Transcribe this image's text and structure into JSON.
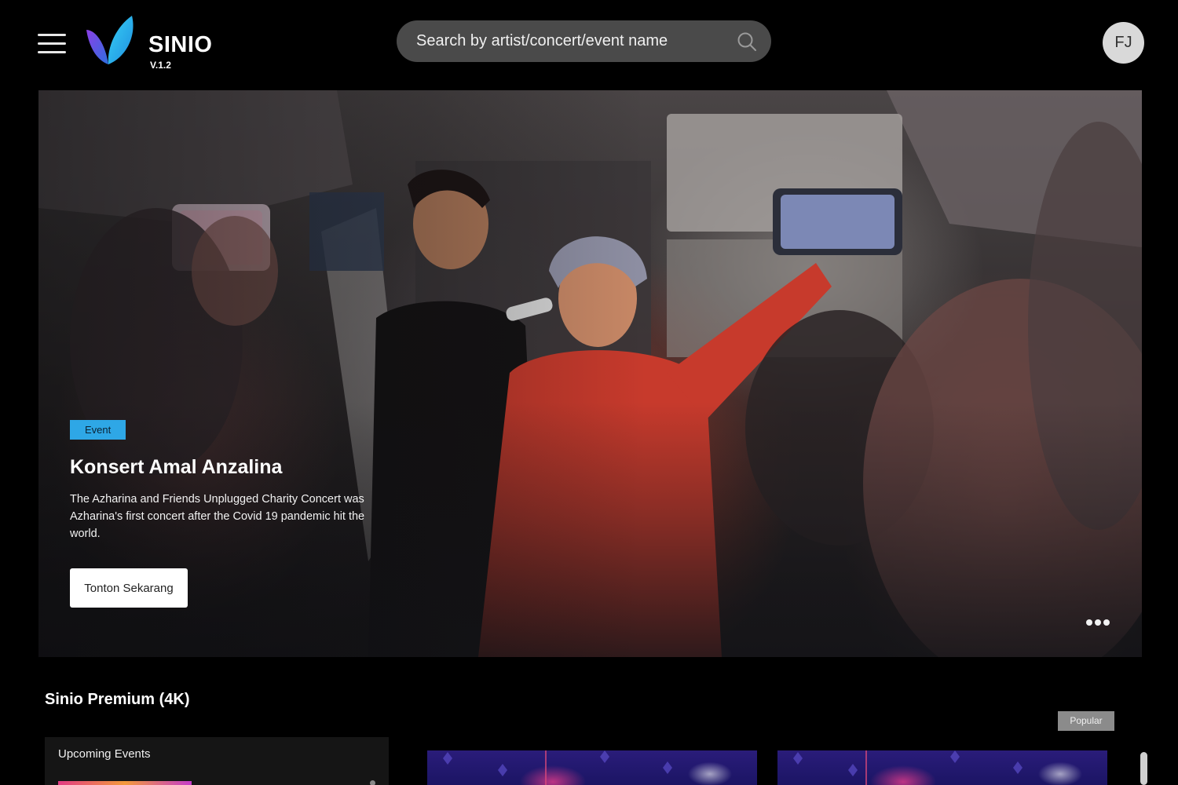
{
  "header": {
    "menu_icon": "hamburger-menu-icon",
    "brand": {
      "name": "SINIO",
      "version": "V.1.2",
      "logo_colors": [
        "#7b3fe0",
        "#2ea7e6",
        "#30c8f0"
      ]
    },
    "search": {
      "placeholder": "Search by artist/concert/event name",
      "value": "",
      "icon": "search-icon"
    },
    "user": {
      "initials": "FJ"
    }
  },
  "hero": {
    "badge": "Event",
    "title": "Konsert Amal Anzalina",
    "description": "The Azharina and Friends Unplugged Charity Concert was Azharina's first concert after the Covid 19 pandemic hit the world.",
    "cta_label": "Tonton Sekarang",
    "more_icon": "more-dots-icon"
  },
  "premium": {
    "title": "Sinio Premium (4K)",
    "popular_badge": "Popular",
    "upcoming": {
      "title": "Upcoming Events"
    }
  },
  "colors": {
    "accent": "#2ea7e6",
    "background": "#000000",
    "search_bg": "#4a4a4a",
    "badge_grey": "#8b8b8b"
  }
}
